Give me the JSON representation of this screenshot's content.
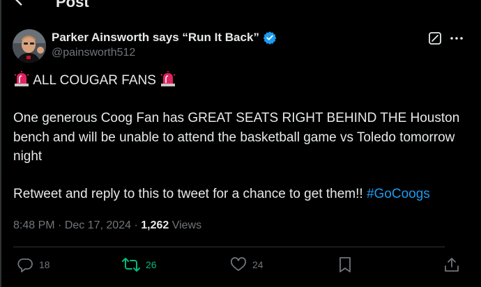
{
  "header": {
    "title": "Post"
  },
  "author": {
    "display_name": "Parker Ainsworth says “Run It Back”",
    "handle": "@painsworth512"
  },
  "tweet": {
    "line1_text": "ALL COUGAR FANS",
    "line2": "One generous Coog Fan has GREAT SEATS RIGHT BEHIND THE  Houston bench and will be unable to attend the basketball game vs Toledo tomorrow night",
    "line3": "Retweet and reply to this to tweet for a chance to get them!! ",
    "hashtag": "#GoCoogs"
  },
  "meta": {
    "time": "8:48 PM",
    "sep1": " · ",
    "date": "Dec 17, 2024",
    "sep2": " · ",
    "views_count": "1,262",
    "views_label": " Views"
  },
  "actions": {
    "replies": "18",
    "reposts": "26",
    "likes": "24"
  },
  "colors": {
    "background": "#000000",
    "text": "#e7e9ea",
    "muted": "#71767b",
    "accent": "#1d9bf0",
    "repost_active": "#00ba7c",
    "divider": "#2f3336"
  },
  "icons": [
    "back-arrow-icon",
    "verified-badge-icon",
    "grok-icon",
    "more-icon",
    "siren-icon",
    "reply-icon",
    "repost-icon",
    "like-icon",
    "bookmark-icon",
    "share-icon"
  ]
}
